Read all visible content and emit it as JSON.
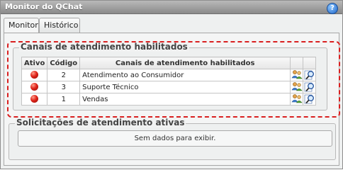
{
  "window": {
    "title": "Monitor do QChat",
    "help_icon": "help-icon"
  },
  "tabs": [
    {
      "label": "Monitor",
      "active": true
    },
    {
      "label": "Histórico",
      "active": false
    }
  ],
  "channels_group": {
    "legend": "Canais de atendimento habilitados",
    "highlight_color": "#d92020",
    "columns": [
      "Ativo",
      "Código",
      "Canais de atendimento habilitados"
    ],
    "rows": [
      {
        "status": "red-bulb-icon",
        "code": "2",
        "name": "Atendimento ao Consumidor",
        "icons": [
          "users-settings-icon",
          "magnifier-search-icon"
        ]
      },
      {
        "status": "red-bulb-icon",
        "code": "3",
        "name": "Suporte Técnico",
        "icons": [
          "users-settings-icon",
          "magnifier-search-icon"
        ]
      },
      {
        "status": "red-bulb-icon",
        "code": "1",
        "name": "Vendas",
        "icons": [
          "users-settings-icon",
          "magnifier-search-icon"
        ]
      }
    ]
  },
  "requests_group": {
    "legend": "Solicitações de atendimento ativas",
    "empty_message": "Sem dados para exibir."
  }
}
